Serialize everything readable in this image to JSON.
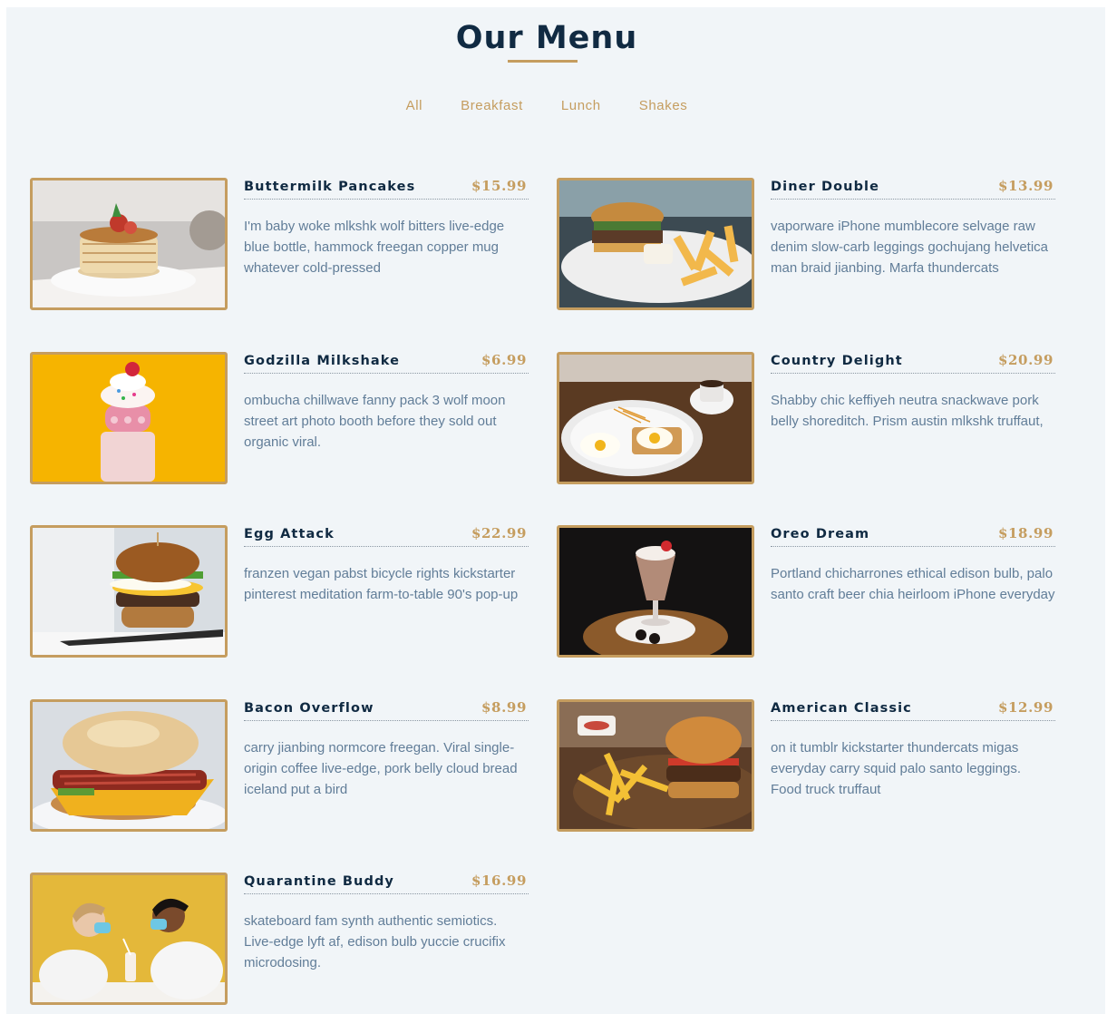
{
  "title": "Our Menu",
  "filters": [
    "All",
    "Breakfast",
    "Lunch",
    "Shakes"
  ],
  "items": [
    {
      "name": "Buttermilk Pancakes",
      "price": "$15.99",
      "desc": "I'm baby woke mlkshk wolf bitters live-edge blue bottle, hammock freegan copper mug whatever cold-pressed",
      "image": "pancakes-photo"
    },
    {
      "name": "Diner Double",
      "price": "$13.99",
      "desc": "vaporware iPhone mumblecore selvage raw denim slow-carb leggings gochujang helvetica man braid jianbing. Marfa thundercats",
      "image": "burger-fries-photo"
    },
    {
      "name": "Godzilla Milkshake",
      "price": "$6.99",
      "desc": "ombucha chillwave fanny pack 3 wolf moon street art photo booth before they sold out organic viral.",
      "image": "milkshake-photo"
    },
    {
      "name": "Country Delight",
      "price": "$20.99",
      "desc": "Shabby chic keffiyeh neutra snackwave pork belly shoreditch. Prism austin mlkshk truffaut,",
      "image": "eggs-toast-photo"
    },
    {
      "name": "Egg Attack",
      "price": "$22.99",
      "desc": "franzen vegan pabst bicycle rights kickstarter pinterest meditation farm-to-table 90's pop-up",
      "image": "egg-burger-photo"
    },
    {
      "name": "Oreo Dream",
      "price": "$18.99",
      "desc": "Portland chicharrones ethical edison bulb, palo santo craft beer chia heirloom iPhone everyday",
      "image": "oreo-shake-photo"
    },
    {
      "name": "Bacon Overflow",
      "price": "$8.99",
      "desc": "carry jianbing normcore freegan. Viral single-origin coffee live-edge, pork belly cloud bread iceland put a bird",
      "image": "bacon-sandwich-photo"
    },
    {
      "name": "American Classic",
      "price": "$12.99",
      "desc": "on it tumblr kickstarter thundercats migas everyday carry squid palo santo leggings. Food truck truffaut",
      "image": "classic-burger-photo"
    },
    {
      "name": "Quarantine Buddy",
      "price": "$16.99",
      "desc": "skateboard fam synth authentic semiotics. Live-edge lyft af, edison bulb yuccie crucifix microdosing.",
      "image": "masked-couple-photo"
    }
  ],
  "colors": {
    "accent": "#c59d5f",
    "heading": "#102a42",
    "text": "#617d98",
    "background": "#f1f5f8"
  }
}
